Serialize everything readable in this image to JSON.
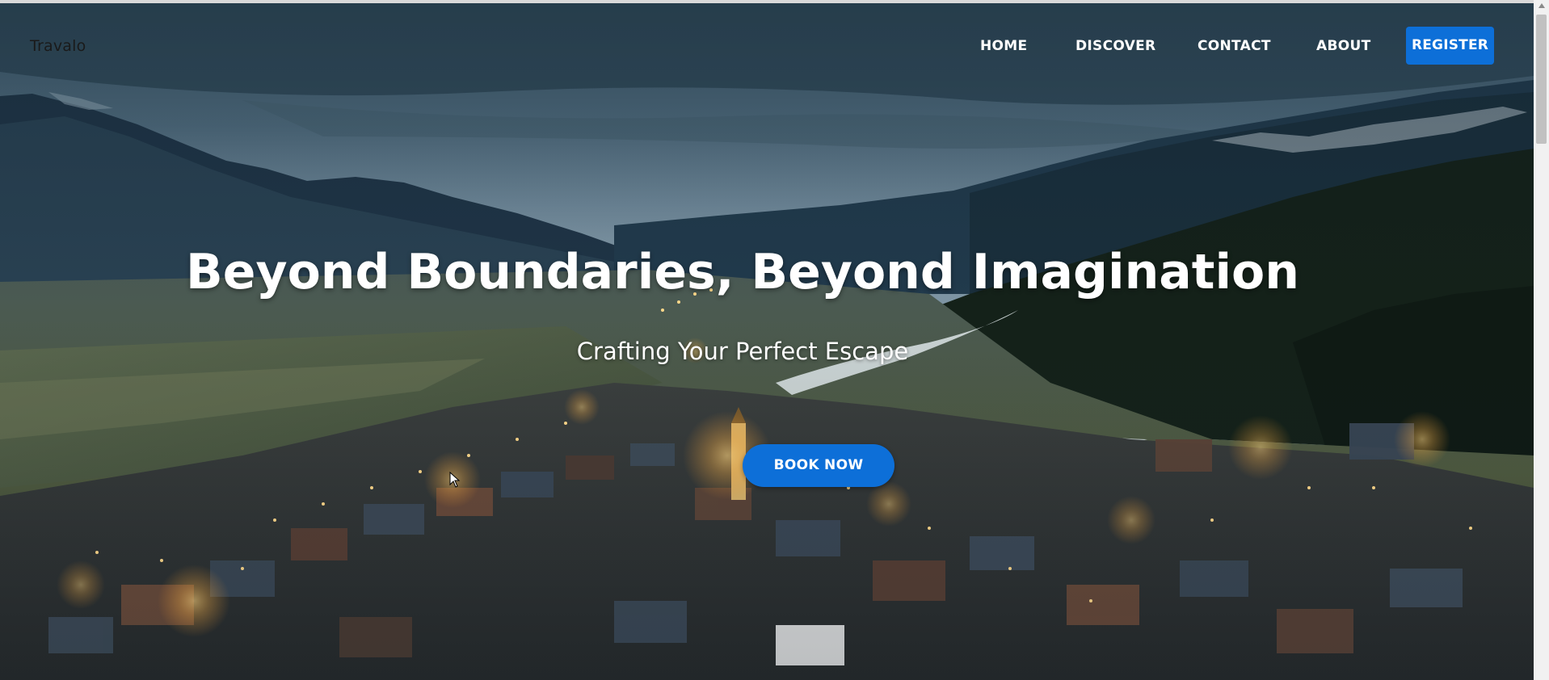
{
  "brand": {
    "name": "Travalo"
  },
  "nav": {
    "items": [
      {
        "label": "HOME"
      },
      {
        "label": "DISCOVER"
      },
      {
        "label": "CONTACT"
      },
      {
        "label": "ABOUT"
      }
    ],
    "register_label": "REGISTER"
  },
  "hero": {
    "headline": "Beyond Boundaries, Beyond Imagination",
    "subheadline": "Crafting Your Perfect Escape",
    "cta_label": "BOOK NOW",
    "image_icon": "mountain-village-at-dusk"
  },
  "colors": {
    "accent": "#0d6fd8",
    "brand_text": "#1a1a1a",
    "nav_text": "#ffffff"
  }
}
